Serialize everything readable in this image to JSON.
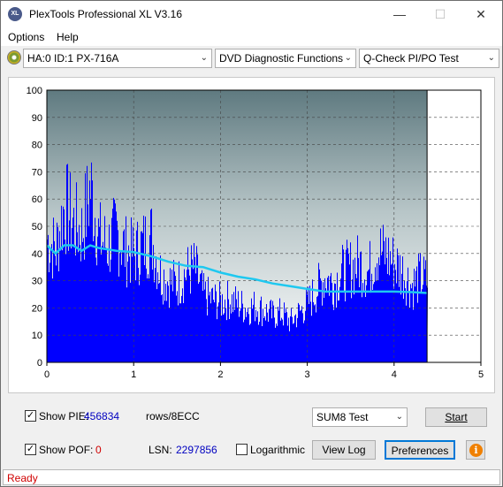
{
  "window": {
    "title": "PlexTools Professional XL V3.16",
    "icon_label": "XL"
  },
  "menu": [
    {
      "label": "Options"
    },
    {
      "label": "Help"
    }
  ],
  "toolbar": {
    "drive": "HA:0 ID:1  PX-716A",
    "function": "DVD Diagnostic Functions",
    "test": "Q-Check PI/PO Test"
  },
  "chart_data": {
    "type": "area",
    "x_ticks": [
      "0",
      "1",
      "2",
      "3",
      "4",
      "5"
    ],
    "y_ticks": [
      "0",
      "10",
      "20",
      "30",
      "40",
      "50",
      "60",
      "70",
      "80",
      "90",
      "100"
    ],
    "xlim": [
      0,
      5
    ],
    "ylim": [
      0,
      100
    ],
    "grid": true,
    "scan_end_x": 4.38,
    "series": [
      {
        "style": "filled-bars",
        "color": "#0000ff",
        "x": [
          0.0,
          0.1,
          0.2,
          0.3,
          0.4,
          0.5,
          0.6,
          0.7,
          0.8,
          0.9,
          1.0,
          1.1,
          1.2,
          1.3,
          1.4,
          1.5,
          1.6,
          1.7,
          1.8,
          1.9,
          2.0,
          2.1,
          2.2,
          2.3,
          2.4,
          2.5,
          2.6,
          2.7,
          2.8,
          2.9,
          3.0,
          3.1,
          3.2,
          3.3,
          3.4,
          3.5,
          3.6,
          3.7,
          3.8,
          3.9,
          4.0,
          4.1,
          4.2,
          4.3,
          4.38
        ],
        "values": [
          55,
          50,
          70,
          62,
          58,
          78,
          55,
          52,
          58,
          50,
          48,
          52,
          56,
          40,
          36,
          35,
          40,
          42,
          30,
          28,
          27,
          28,
          26,
          24,
          25,
          23,
          21,
          22,
          18,
          22,
          26,
          32,
          38,
          35,
          40,
          42,
          44,
          40,
          50,
          48,
          44,
          40,
          34,
          38,
          36
        ]
      },
      {
        "style": "line",
        "color": "#1ec8f0",
        "x": [
          0.0,
          0.1,
          0.2,
          0.3,
          0.4,
          0.5,
          0.6,
          0.8,
          1.0,
          1.2,
          1.4,
          1.6,
          1.8,
          2.0,
          2.2,
          2.4,
          2.6,
          2.8,
          3.0,
          3.2,
          3.5,
          3.8,
          4.0,
          4.2,
          4.38
        ],
        "values": [
          43,
          40,
          43,
          43,
          41,
          43,
          42,
          41,
          40.5,
          39,
          37,
          35.5,
          35,
          33,
          31.5,
          30.5,
          29,
          28,
          27,
          26,
          26,
          26,
          26,
          25.8,
          25.5
        ]
      }
    ]
  },
  "controls": {
    "show_pie_label": "Show PIE:",
    "show_pie_checked": "✓",
    "pie_value": "456834",
    "rows_label": "rows/8ECC",
    "show_pof_label": "Show POF:",
    "show_pof_checked": "✓",
    "pof_value": "0",
    "lsn_label": "LSN:",
    "lsn_value": "2297856",
    "logarithmic_label": "Logarithmic",
    "test_mode": "SUM8 Test",
    "start_label": "Start",
    "view_log_label": "View Log",
    "preferences_label": "Preferences"
  },
  "status": {
    "text": "Ready"
  }
}
